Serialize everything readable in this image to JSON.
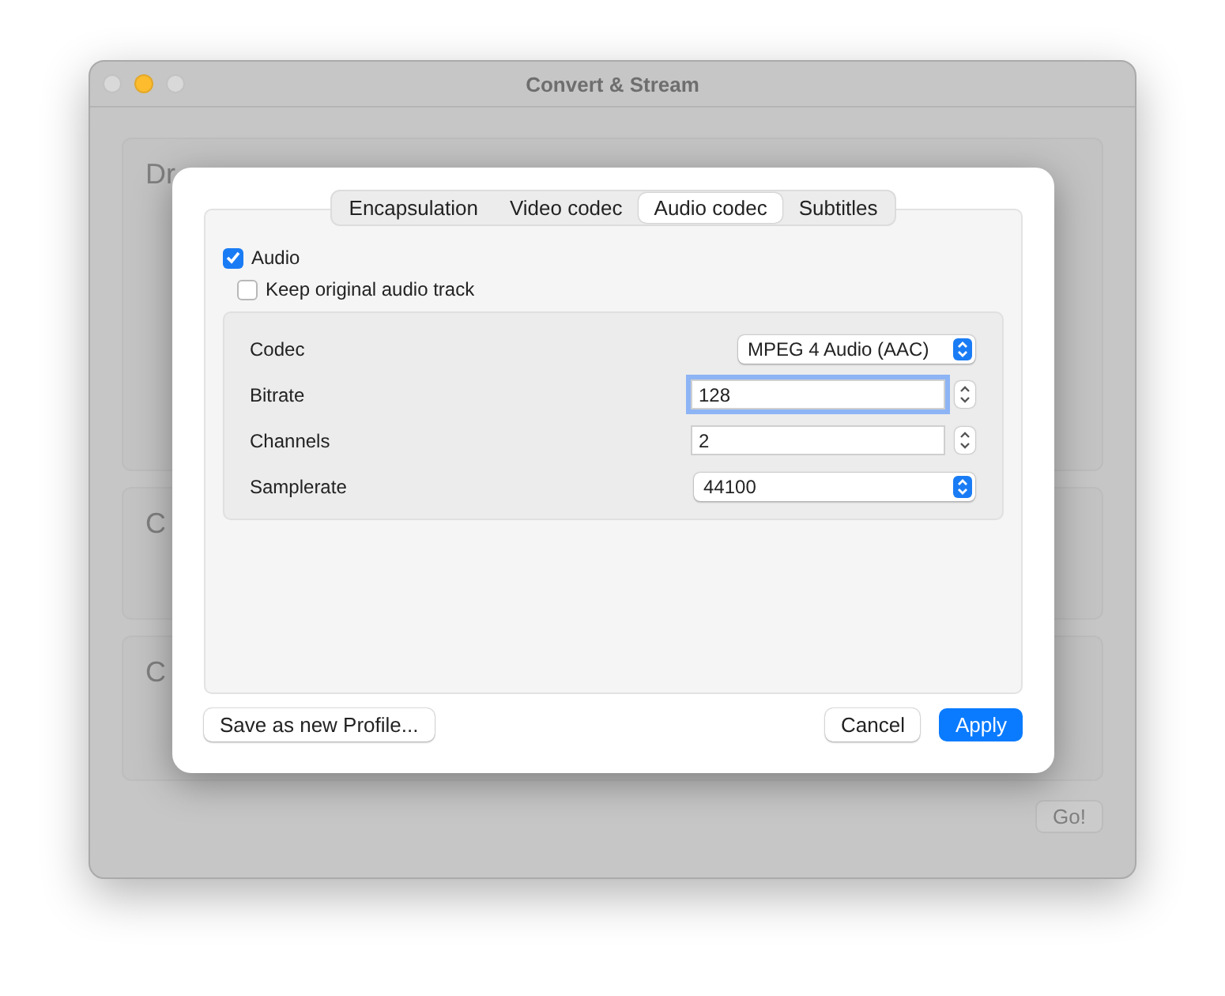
{
  "window": {
    "title": "Convert & Stream"
  },
  "background": {
    "sections": [
      {
        "heading": "Dr"
      },
      {
        "heading": "C"
      },
      {
        "heading": "C"
      }
    ],
    "go_button": "Go!"
  },
  "dialog": {
    "tabs": [
      {
        "label": "Encapsulation",
        "selected": false
      },
      {
        "label": "Video codec",
        "selected": false
      },
      {
        "label": "Audio codec",
        "selected": true
      },
      {
        "label": "Subtitles",
        "selected": false
      }
    ],
    "audio_checkbox": {
      "label": "Audio",
      "checked": true
    },
    "keep_checkbox": {
      "label": "Keep original audio track",
      "checked": false
    },
    "settings": [
      {
        "kind": "popup",
        "label": "Codec",
        "value": "MPEG 4 Audio (AAC)",
        "wide": false
      },
      {
        "kind": "stepper",
        "label": "Bitrate",
        "value": "128",
        "focused": true
      },
      {
        "kind": "stepper",
        "label": "Channels",
        "value": "2",
        "focused": false
      },
      {
        "kind": "popup",
        "label": "Samplerate",
        "value": "44100",
        "wide": true
      }
    ],
    "save_button": "Save as new Profile...",
    "cancel_button": "Cancel",
    "apply_button": "Apply"
  }
}
